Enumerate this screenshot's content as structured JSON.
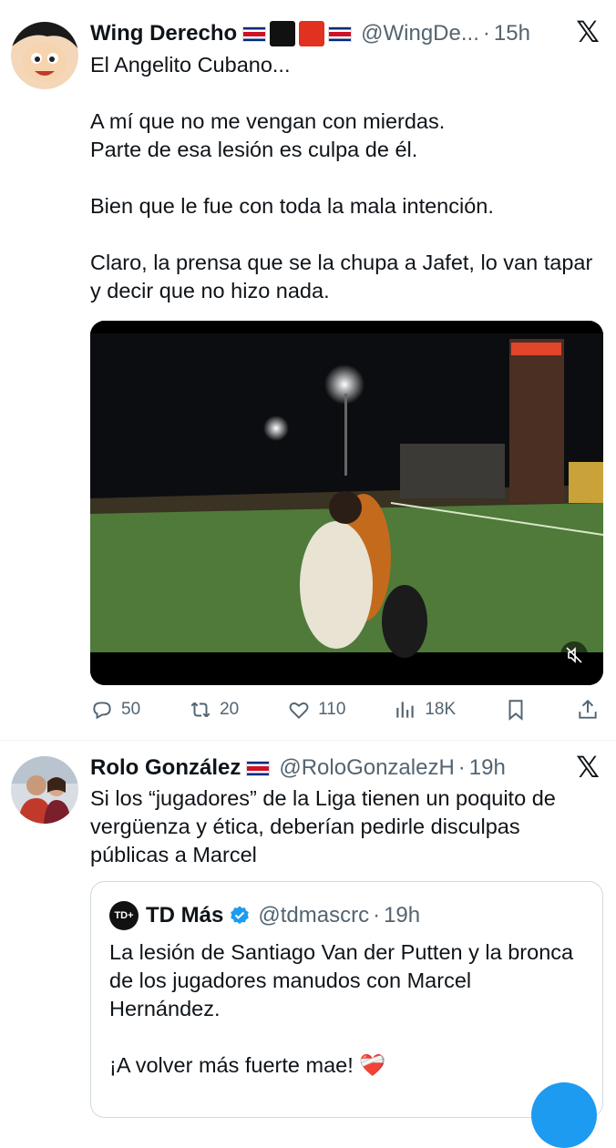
{
  "tweets": [
    {
      "name": "Wing Derecho",
      "handle": "@WingDe...",
      "dot": "·",
      "time": "15h",
      "text": "El Angelito Cubano...\n\nA mí que no me vengan con mierdas.\nParte de esa lesión es culpa de él.\n\nBien que le fue con toda la mala intención.\n\nClaro, la prensa que se la chupa a Jafet, lo van tapar y decir que no hizo nada.",
      "stats": {
        "replies": "50",
        "reposts": "20",
        "likes": "110",
        "views": "18K"
      }
    },
    {
      "name": "Rolo González",
      "handle": "@RoloGonzalezH",
      "dot": "·",
      "time": "19h",
      "text": "Si los “jugadores” de la Liga tienen un poquito de vergüenza y ética, deberían pedirle disculpas públicas a Marcel",
      "quote": {
        "avatar_text": "TD+",
        "name": "TD Más",
        "handle": "@tdmascrc",
        "dot": "·",
        "time": "19h",
        "text": "La lesión de Santiago Van der Putten y la bronca de los jugadores manudos con Marcel Hernández.\n\n¡A volver más fuerte mae! ❤️‍🩹"
      }
    }
  ],
  "brand": {
    "x_logo": "𝕏"
  },
  "colors": {
    "accent": "#1d9bf0",
    "muted": "#536471",
    "text": "#0f1419"
  },
  "icons": [
    "reply-icon",
    "repost-icon",
    "like-icon",
    "views-icon",
    "bookmark-icon",
    "share-icon",
    "mute-icon",
    "verified-icon"
  ]
}
